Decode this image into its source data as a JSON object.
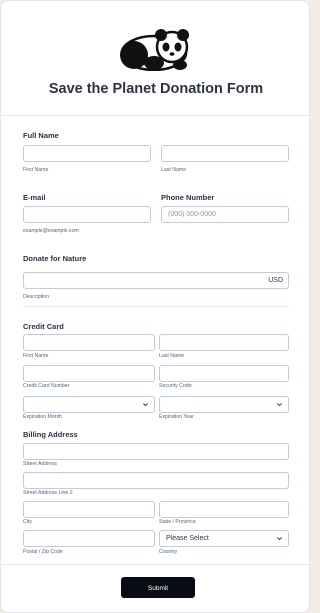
{
  "form": {
    "title": "Save the Planet Donation Form",
    "full_name": {
      "label": "Full Name",
      "first_sub": "First Name",
      "last_sub": "Last Name"
    },
    "email": {
      "label": "E-mail",
      "sub": "example@example.com"
    },
    "phone": {
      "label": "Phone Number",
      "placeholder": "(000) 000-0000"
    },
    "donate": {
      "label": "Donate for Nature",
      "currency": "USD",
      "sub": "Description"
    },
    "credit_card": {
      "label": "Credit Card",
      "first_sub": "First Name",
      "last_sub": "Last Name",
      "number_sub": "Credit Card Number",
      "code_sub": "Security Code",
      "month_sub": "Expiration Month",
      "year_sub": "Expiration Year"
    },
    "billing": {
      "label": "Billing Address",
      "street_sub": "Street Address",
      "street2_sub": "Street Address Line 2",
      "city_sub": "City",
      "state_sub": "State / Province",
      "postal_sub": "Postal / Zip Code",
      "country_sub": "Country",
      "country_value": "Please Select"
    },
    "submit_label": "Submit"
  },
  "icons": {
    "logo": "panda-logo-icon",
    "select": "chevron-down-icon"
  }
}
